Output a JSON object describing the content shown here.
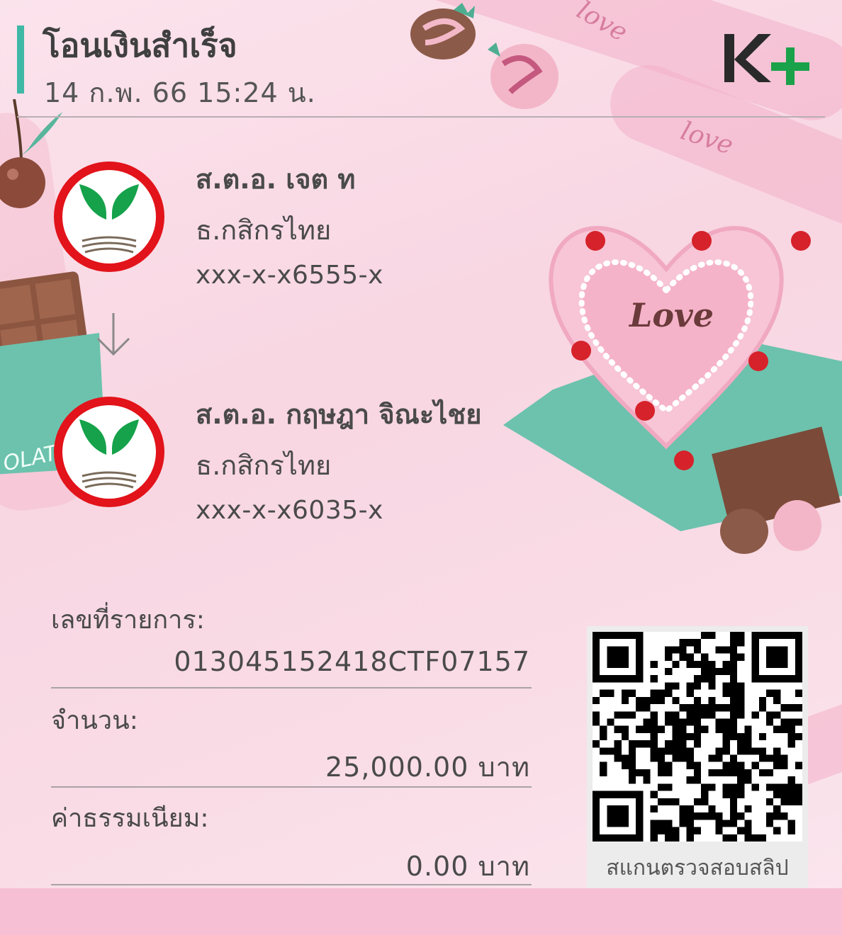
{
  "header": {
    "title": "โอนเงินสำเร็จ",
    "datetime": "14 ก.พ. 66  15:24 น.",
    "brand_logo": "K+",
    "brand_icon": "kplus-logo"
  },
  "colors": {
    "accent": "#3fb8a6",
    "brand_green": "#1aa24a",
    "brand_dark": "#2a2a2a",
    "kbank_red": "#e2131a",
    "kbank_green": "#15a24a",
    "background_pink": "#f8d6e2",
    "bottom_bar": "#f6bfd4"
  },
  "sender": {
    "name": "ส.ต.อ. เจต ท",
    "bank": "ธ.กสิกรไทย",
    "account": "xxx-x-x6555-x",
    "icon": "kbank-logo-icon"
  },
  "transfer_arrow_icon": "arrow-down-icon",
  "receiver": {
    "name": "ส.ต.อ. กฤษฎา จิณะไชย",
    "bank": "ธ.กสิกรไทย",
    "account": "xxx-x-x6035-x",
    "icon": "kbank-logo-icon"
  },
  "details": {
    "reference_label": "เลขที่รายการ:",
    "reference_value": "013045152418CTF07157",
    "amount_label": "จำนวน:",
    "amount_value": "25,000.00 บาท",
    "fee_label": "ค่าธรรมเนียม:",
    "fee_value": "0.00 บาท"
  },
  "qr": {
    "caption": "สแกนตรวจสอบสลิป",
    "icon": "qr-code-icon"
  },
  "background_decoration": {
    "script_text": [
      "love",
      "Love",
      "love"
    ],
    "chocolate_text": "OLATE"
  }
}
